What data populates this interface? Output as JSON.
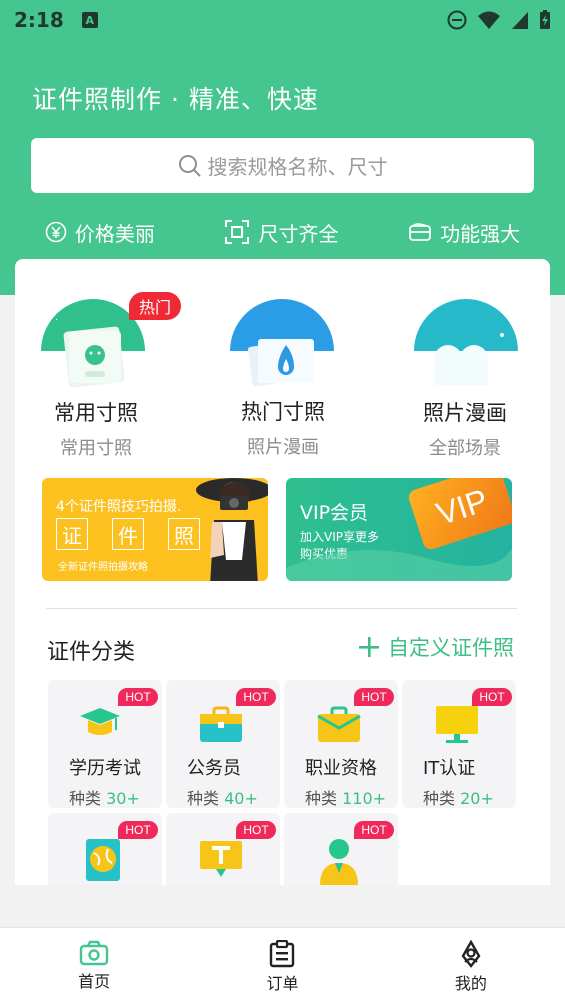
{
  "status_bar": {
    "time": "2:18",
    "notif_letter": "A"
  },
  "header": {
    "title": "证件照制作 · 精准、快速",
    "search_placeholder": "搜索规格名称、尺寸",
    "features": [
      {
        "icon": "yuan-icon",
        "label": "价格美丽"
      },
      {
        "icon": "frame-icon",
        "label": "尺寸齐全"
      },
      {
        "icon": "wallet-icon",
        "label": "功能强大"
      }
    ]
  },
  "categories": [
    {
      "title": "常用寸照",
      "subtitle": "常用寸照",
      "badge": "热门"
    },
    {
      "title": "热门寸照",
      "subtitle": "照片漫画"
    },
    {
      "title": "照片漫画",
      "subtitle": "全部场景"
    }
  ],
  "banners": {
    "left": {
      "title": "4个证件照技巧拍摄.",
      "chars": [
        "证",
        "件",
        "照"
      ],
      "caption": "全新证件照拍摄攻略"
    },
    "right": {
      "title": "VIP会员",
      "line1": "加入VIP享更多",
      "line2": "购买优惠",
      "badge": "VIP"
    }
  },
  "section": {
    "title": "证件分类",
    "custom_link": "自定义证件照"
  },
  "tiles": [
    {
      "name": "学历考试",
      "count_prefix": "种类",
      "count": "30+",
      "badge": "HOT",
      "icon": "graduation-cap-icon"
    },
    {
      "name": "公务员",
      "count_prefix": "种类",
      "count": "40+",
      "badge": "HOT",
      "icon": "briefcase-icon"
    },
    {
      "name": "职业资格",
      "count_prefix": "种类",
      "count": "110+",
      "badge": "HOT",
      "icon": "folder-icon"
    },
    {
      "name": "IT认证",
      "count_prefix": "种类",
      "count": "20+",
      "badge": "HOT",
      "icon": "monitor-icon"
    },
    {
      "badge": "HOT",
      "icon": "globe-book-icon"
    },
    {
      "badge": "HOT",
      "icon": "t-sign-icon"
    },
    {
      "badge": "HOT",
      "icon": "person-icon"
    }
  ],
  "bottom_nav": [
    {
      "label": "首页",
      "icon": "camera-icon",
      "active": true
    },
    {
      "label": "订单",
      "icon": "clipboard-icon"
    },
    {
      "label": "我的",
      "icon": "user-icon"
    }
  ],
  "colors": {
    "primary": "#45c58f",
    "accent": "#3bbf85",
    "hot": "#ef2a36",
    "banner_yellow": "#fcc11f"
  }
}
